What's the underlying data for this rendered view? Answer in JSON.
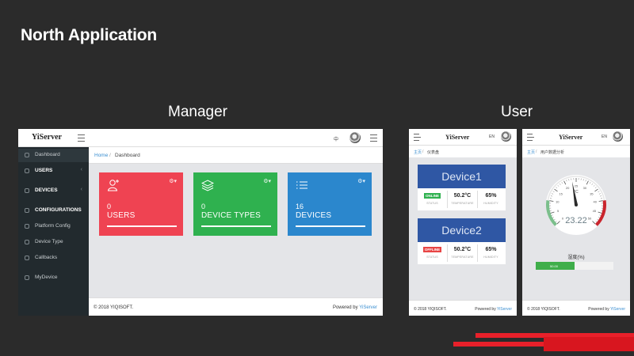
{
  "slide": {
    "title": "North Application",
    "manager_label": "Manager",
    "user_label": "User"
  },
  "colors": {
    "background": "#2b2b2b",
    "sidebar": "#222a2e",
    "card_users": "#ef4352",
    "card_device_types": "#2fb14f",
    "card_devices": "#2b87cd",
    "device_header": "#2f57a4",
    "online": "#2fb14f",
    "offline": "#e84545",
    "accent_stripe": "#e8202a"
  },
  "manager": {
    "logo": "YiServer",
    "lang": "中",
    "sidebar": {
      "items": [
        {
          "label": "Dashboard",
          "icon": "dashboard-icon",
          "chevron": ""
        },
        {
          "label": "USERS",
          "icon": "users-icon",
          "chevron": "‹"
        },
        {
          "label": "DEVICES",
          "icon": "devices-icon",
          "chevron": "‹"
        },
        {
          "label": "CONFIGURATIONS",
          "icon": "config-icon",
          "chevron": ""
        },
        {
          "label": "Platform Config",
          "icon": "settings-icon",
          "chevron": ""
        },
        {
          "label": "Device Type",
          "icon": "type-icon",
          "chevron": ""
        },
        {
          "label": "Callbacks",
          "icon": "callback-icon",
          "chevron": ""
        },
        {
          "label": "MyDevice",
          "icon": "mydevice-icon",
          "chevron": ""
        }
      ],
      "collapse": "‹"
    },
    "breadcrumb": {
      "home": "Home",
      "sep": "/",
      "current": "Dashboard"
    },
    "cards": [
      {
        "value": "0",
        "label": "USERS",
        "icon": "user-icon",
        "gear": "⚙▾"
      },
      {
        "value": "0",
        "label": "DEVICE TYPES",
        "icon": "layers-icon",
        "gear": "⚙▾"
      },
      {
        "value": "16",
        "label": "DEVICES",
        "icon": "list-icon",
        "gear": "⚙▾"
      }
    ],
    "footer": {
      "left": "© 2018 YIQISOFT.",
      "right_prefix": "Powered by ",
      "right_brand": "YiServer"
    }
  },
  "user_phone1": {
    "logo": "YiServer",
    "lang": "EN",
    "breadcrumb": {
      "home": "主页",
      "sep": "/",
      "current": "仪表盘"
    },
    "devices": [
      {
        "name": "Device1",
        "status": "ONLINE",
        "temperature": "50.2°C",
        "humidity": "65%",
        "status_label": "STATUS",
        "temperature_label": "TEMPERATURE",
        "humidity_label": "HUMIDITY"
      },
      {
        "name": "Device2",
        "status": "OFFLINE",
        "temperature": "50.2°C",
        "humidity": "65%",
        "status_label": "STATUS",
        "temperature_label": "TEMPERATURE",
        "humidity_label": "HUMIDITY"
      }
    ],
    "footer": {
      "left": "© 2018 YIQISOFT.",
      "right_prefix": "Powered by ",
      "right_brand": "YiServer"
    }
  },
  "user_phone2": {
    "logo": "YiServer",
    "lang": "EN",
    "breadcrumb": {
      "home": "主页",
      "sep": "/",
      "current": "用户数据分析"
    },
    "gauge": {
      "value": "23.22",
      "ticks": [
        "0",
        "5",
        "10",
        "15",
        "20",
        "25",
        "30",
        "35",
        "40",
        "45",
        "50"
      ],
      "unit": "°C"
    },
    "humidity": {
      "title": "湿度(%)",
      "value": 50,
      "label": "50.00"
    },
    "footer": {
      "left": "© 2018 YIQISOFT.",
      "right_prefix": "Powered by ",
      "right_brand": "YiServer"
    }
  }
}
